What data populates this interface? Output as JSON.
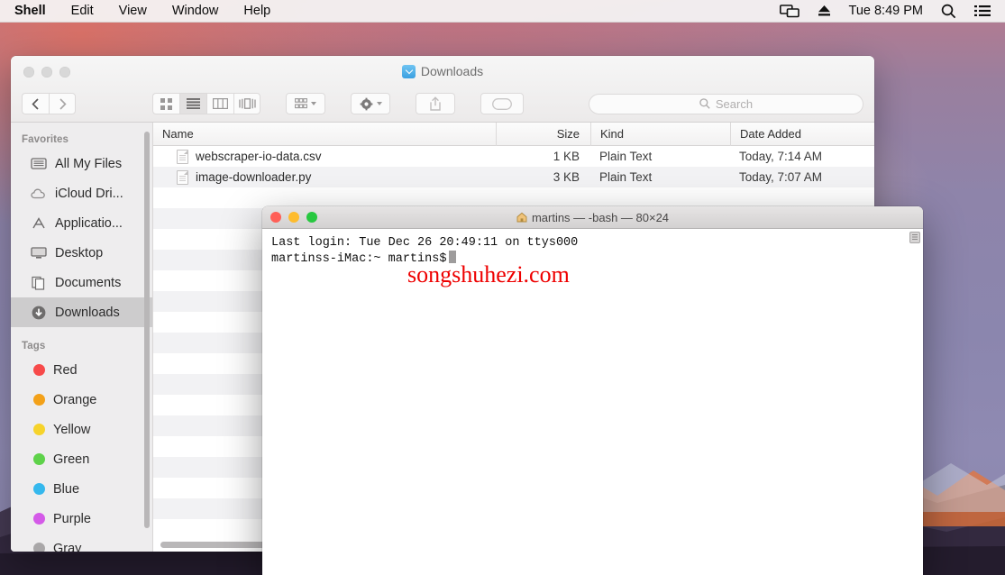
{
  "menubar": {
    "items": [
      {
        "label": "Shell",
        "name": "menu-shell"
      },
      {
        "label": "Edit",
        "name": "menu-edit"
      },
      {
        "label": "View",
        "name": "menu-view"
      },
      {
        "label": "Window",
        "name": "menu-window"
      },
      {
        "label": "Help",
        "name": "menu-help"
      }
    ],
    "status": {
      "screen_icon": "screen-mirroring-icon",
      "eject_icon": "eject-icon",
      "clock": "Tue 8:49 PM",
      "search_icon": "spotlight-search-icon",
      "list_icon": "notification-center-icon"
    }
  },
  "finder": {
    "title": "Downloads",
    "title_icon": "downloads-folder-icon",
    "traffic": {
      "close": "close-button",
      "minimize": "minimize-button",
      "zoom": "zoom-button"
    },
    "toolbar": {
      "back": "back-arrow-icon",
      "forward": "forward-arrow-icon",
      "view_icon": "icon-view-button",
      "view_list": "list-view-button",
      "view_column": "column-view-button",
      "view_coverflow": "coverflow-view-button",
      "arrange": "arrange-by-button",
      "action": "action-gear-button",
      "share": "share-button",
      "tags": "tags-button"
    },
    "search": {
      "placeholder": "Search",
      "value": "",
      "icon": "search-icon"
    },
    "sidebar": {
      "sections": [
        {
          "header": "Favorites",
          "items": [
            {
              "label": "All My Files",
              "icon": "all-my-files-icon",
              "selected": false
            },
            {
              "label": "iCloud Dri...",
              "icon": "icloud-drive-icon",
              "selected": false
            },
            {
              "label": "Applicatio...",
              "icon": "applications-icon",
              "selected": false
            },
            {
              "label": "Desktop",
              "icon": "desktop-icon",
              "selected": false
            },
            {
              "label": "Documents",
              "icon": "documents-icon",
              "selected": false
            },
            {
              "label": "Downloads",
              "icon": "downloads-icon",
              "selected": true
            }
          ]
        },
        {
          "header": "Tags",
          "items": [
            {
              "label": "Red",
              "color": "#f74a4a",
              "selected": false
            },
            {
              "label": "Orange",
              "color": "#f3a119",
              "selected": false
            },
            {
              "label": "Yellow",
              "color": "#f6d32b",
              "selected": false
            },
            {
              "label": "Green",
              "color": "#5ed24a",
              "selected": false
            },
            {
              "label": "Blue",
              "color": "#35b8ed",
              "selected": false
            },
            {
              "label": "Purple",
              "color": "#d45ae8",
              "selected": false
            },
            {
              "label": "Gray",
              "color": "#a9a7a8",
              "selected": false
            }
          ]
        }
      ]
    },
    "columns": [
      "Name",
      "Size",
      "Kind",
      "Date Added"
    ],
    "files": [
      {
        "name": "webscraper-io-data.csv",
        "size": "1 KB",
        "kind": "Plain Text",
        "date": "Today, 7:14 AM"
      },
      {
        "name": "image-downloader.py",
        "size": "3 KB",
        "kind": "Plain Text",
        "date": "Today, 7:07 AM"
      }
    ],
    "empty_row_count": 17
  },
  "terminal": {
    "title": "martins — -bash — 80×24",
    "title_icon": "home-folder-icon",
    "traffic": {
      "close": "#ff5f57",
      "minimize": "#febc2e",
      "zoom": "#28c840"
    },
    "lines": [
      "Last login: Tue Dec 26 20:49:11 on ttys000",
      "martinss-iMac:~ martins$"
    ]
  },
  "watermark": {
    "text": "songshuhezi.com",
    "color": "#ee0000"
  }
}
